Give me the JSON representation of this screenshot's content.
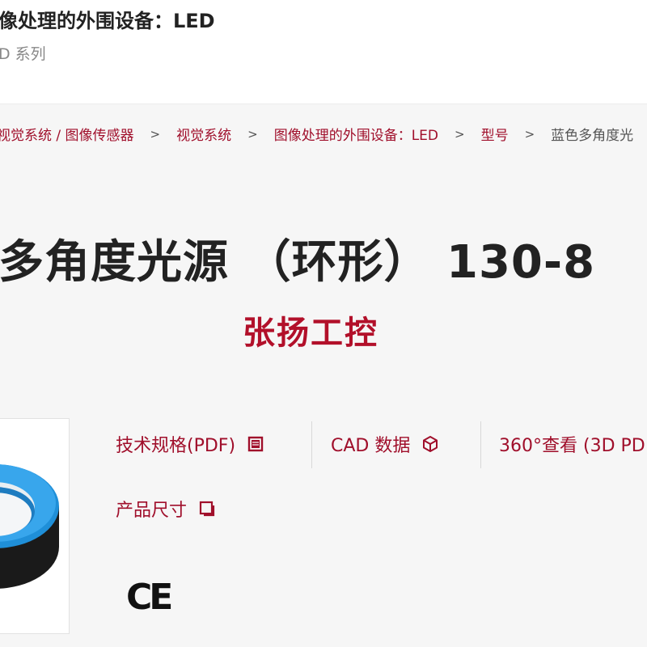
{
  "header": {
    "title": "像处理的外围设备：LED",
    "subtitle": "D 系列"
  },
  "breadcrumb": {
    "items": [
      "视觉系统 / 图像传感器",
      "视觉系统",
      "图像处理的外围设备：LED",
      "型号",
      "蓝色多角度光"
    ],
    "separator": ">"
  },
  "product": {
    "title": "多角度光源 （环形） 130-8",
    "watermark": "张扬工控"
  },
  "links": {
    "specs": "技术规格(PDF)",
    "cad": "CAD 数据",
    "view360": "360°查看 (3D PD",
    "dimensions": "产品尺寸"
  },
  "certification": "CE",
  "colors": {
    "brand_red": "#a00f2b",
    "watermark_red": "#b2102a",
    "ring_blue": "#1f8fd8"
  },
  "icons": {
    "specs": "document-list-icon",
    "cad": "cube-icon",
    "dimensions": "dimensions-icon"
  }
}
